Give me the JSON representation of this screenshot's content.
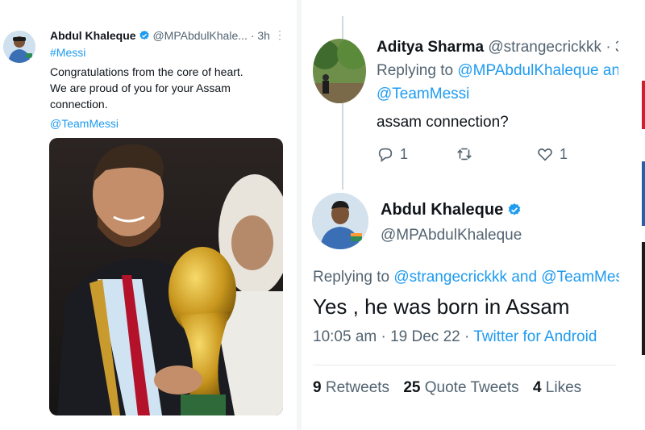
{
  "left_tweet": {
    "name": "Abdul Khaleque",
    "handle": "@MPAbdulKhale...",
    "time": "· 3h",
    "more": "⋮",
    "hashtag": "#Messi",
    "text_line1": "Congratulations from the core of heart.",
    "text_line2": "We are proud of you for your Assam",
    "text_line3": "connection.",
    "mention": "@TeamMessi"
  },
  "reply_tweet": {
    "name": "Aditya Sharma",
    "handle": "@strangecrickkk · 3",
    "replying_prefix": "Replying to",
    "replying_to_1": "@MPAbdulKhaleque anc",
    "replying_to_2": "@TeamMessi",
    "text": "assam connection?",
    "reply_count": "1",
    "retweet_count": "",
    "like_count": "1"
  },
  "main_tweet": {
    "name": "Abdul Khaleque",
    "handle": "@MPAbdulKhaleque",
    "replying_prefix": "Replying to",
    "replying_to": "@strangecrickkk and @TeamMess",
    "text": "Yes , he was born in Assam",
    "timestamp": "10:05 am · 19 Dec 22 ·",
    "source": "Twitter for Android",
    "retweets_count": "9",
    "retweets_label": "Retweets",
    "quotes_count": "25",
    "quotes_label": "Quote Tweets",
    "likes_count": "4",
    "likes_label": "Likes"
  },
  "colors": {
    "link_blue": "#1d9bf0",
    "secondary_text": "#536471",
    "primary_text": "#0f1419"
  },
  "icons": [
    "verified-badge-icon",
    "reply-icon",
    "retweet-icon",
    "like-icon",
    "more-icon"
  ]
}
